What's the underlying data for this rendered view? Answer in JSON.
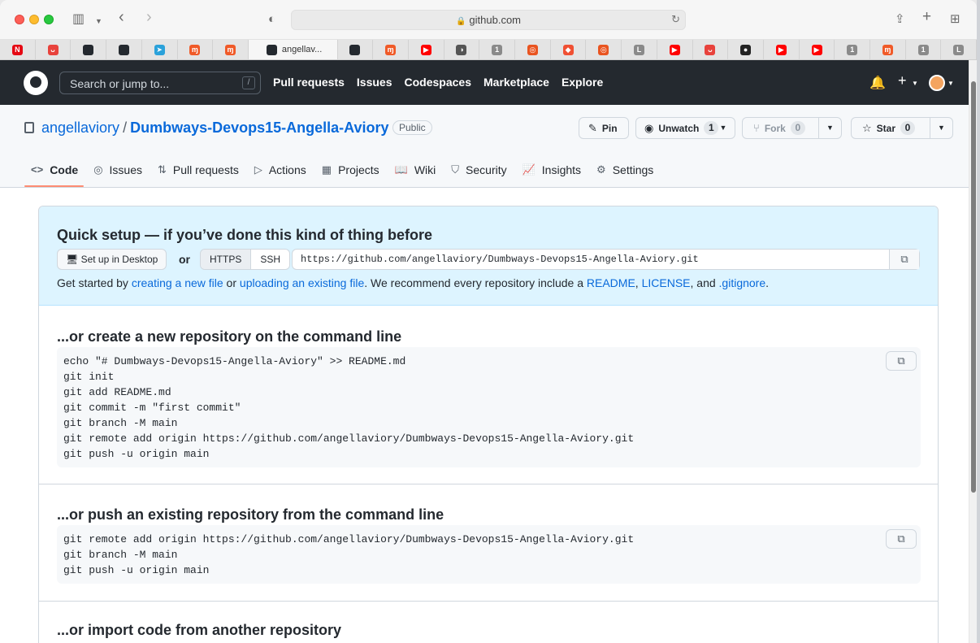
{
  "browser": {
    "address": "github.com",
    "active_tab_title": "angellav...",
    "tabs": [
      {
        "icon": "netflix-icon",
        "color": "#e50914",
        "glyph": "N"
      },
      {
        "icon": "media-icon",
        "color": "#e8423c",
        "glyph": "ᴗ"
      },
      {
        "icon": "github-icon",
        "color": "#24292f",
        "glyph": ""
      },
      {
        "icon": "github-icon",
        "color": "#24292f",
        "glyph": ""
      },
      {
        "icon": "telegram-icon",
        "color": "#2aa1da",
        "glyph": "➤"
      },
      {
        "icon": "app-icon",
        "color": "#f05a28",
        "glyph": "ɱ"
      },
      {
        "icon": "app-icon",
        "color": "#f05a28",
        "glyph": "ɱ"
      },
      {
        "icon": "active-github-tab",
        "color": "#24292f",
        "glyph": ""
      },
      {
        "icon": "github-icon",
        "color": "#24292f",
        "glyph": ""
      },
      {
        "icon": "app-icon",
        "color": "#f05a28",
        "glyph": "ɱ"
      },
      {
        "icon": "youtube-icon",
        "color": "#ff0000",
        "glyph": "▶"
      },
      {
        "icon": "gitbook-icon",
        "color": "#555555",
        "glyph": "◑"
      },
      {
        "icon": "number-one-icon",
        "color": "#8a8a8a",
        "glyph": "1"
      },
      {
        "icon": "ubuntu-icon",
        "color": "#e95420",
        "glyph": "◎"
      },
      {
        "icon": "git-icon",
        "color": "#f05033",
        "glyph": "◆"
      },
      {
        "icon": "ubuntu-icon",
        "color": "#e95420",
        "glyph": "◎"
      },
      {
        "icon": "letter-l-icon",
        "color": "#8a8a8a",
        "glyph": "L"
      },
      {
        "icon": "youtube-icon",
        "color": "#ff0000",
        "glyph": "▶"
      },
      {
        "icon": "media-icon",
        "color": "#e8423c",
        "glyph": "ᴗ"
      },
      {
        "icon": "record-icon",
        "color": "#222222",
        "glyph": "●"
      },
      {
        "icon": "youtube-icon",
        "color": "#ff0000",
        "glyph": "▶"
      },
      {
        "icon": "youtube-icon",
        "color": "#ff0000",
        "glyph": "▶"
      },
      {
        "icon": "number-one-icon",
        "color": "#8a8a8a",
        "glyph": "1"
      },
      {
        "icon": "app-icon",
        "color": "#f05a28",
        "glyph": "ɱ"
      },
      {
        "icon": "number-one-icon",
        "color": "#8a8a8a",
        "glyph": "1"
      },
      {
        "icon": "letter-l-icon",
        "color": "#8a8a8a",
        "glyph": "L"
      }
    ]
  },
  "github": {
    "search_placeholder": "Search or jump to...",
    "search_key": "/",
    "nav": [
      "Pull requests",
      "Issues",
      "Codespaces",
      "Marketplace",
      "Explore"
    ]
  },
  "repo": {
    "owner": "angellaviory",
    "separator": "/",
    "name": "Dumbways-Devops15-Angella-Aviory",
    "visibility": "Public",
    "pin_label": "Pin",
    "watch_label": "Unwatch",
    "watch_count": "1",
    "fork_label": "Fork",
    "fork_count": "0",
    "star_label": "Star",
    "star_count": "0",
    "tabs": [
      {
        "label": "Code",
        "icon": "<>"
      },
      {
        "label": "Issues",
        "icon": "◎"
      },
      {
        "label": "Pull requests",
        "icon": "⇅"
      },
      {
        "label": "Actions",
        "icon": "▷"
      },
      {
        "label": "Projects",
        "icon": "▦"
      },
      {
        "label": "Wiki",
        "icon": "📖"
      },
      {
        "label": "Security",
        "icon": "⛉"
      },
      {
        "label": "Insights",
        "icon": "📈"
      },
      {
        "label": "Settings",
        "icon": "⚙"
      }
    ]
  },
  "quick_setup": {
    "title": "Quick setup — if you’ve done this kind of thing before",
    "desktop_button": "Set up in Desktop",
    "or_label": "or",
    "https_label": "HTTPS",
    "ssh_label": "SSH",
    "clone_url": "https://github.com/angellaviory/Dumbways-Devops15-Angella-Aviory.git",
    "desc": {
      "t1": "Get started by ",
      "l1": "creating a new file",
      "t2": " or ",
      "l2": "uploading an existing file",
      "t3": ". We recommend every repository include a ",
      "l3": "README",
      "t4": ", ",
      "l4": "LICENSE",
      "t5": ", and ",
      "l5": ".gitignore",
      "t6": "."
    }
  },
  "sections": {
    "create": {
      "title": "...or create a new repository on the command line",
      "lines": [
        "echo \"# Dumbways-Devops15-Angella-Aviory\" >> README.md",
        "git init",
        "git add README.md",
        "git commit -m \"first commit\"",
        "git branch -M main",
        "git remote add origin https://github.com/angellaviory/Dumbways-Devops15-Angella-Aviory.git",
        "git push -u origin main"
      ]
    },
    "push": {
      "title": "...or push an existing repository from the command line",
      "lines": [
        "git remote add origin https://github.com/angellaviory/Dumbways-Devops15-Angella-Aviory.git",
        "git branch -M main",
        "git push -u origin main"
      ]
    },
    "import": {
      "title": "...or import code from another repository"
    }
  }
}
